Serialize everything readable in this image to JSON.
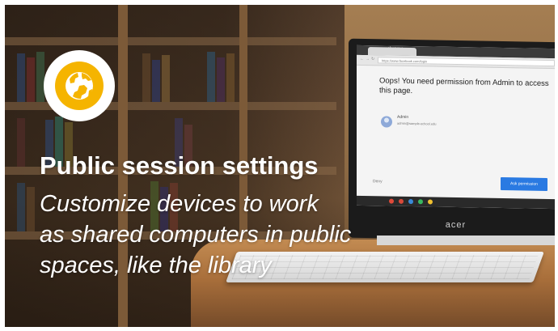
{
  "hero": {
    "title": "Public session settings",
    "subtitle_lines": [
      "Customize devices to work",
      "as shared computers in public",
      "spaces, like the library"
    ],
    "icon": "globe-icon",
    "icon_color": "#F5B400",
    "badge_color": "#FFFFFF"
  },
  "device_screen": {
    "browser_label": "chrome",
    "tab_title": "",
    "url": "https://www.facebook.com/login",
    "message": "Oops! You need permission from Admin to access this page.",
    "admin_name": "Admin",
    "admin_email": "admin@sample-school.edu",
    "deny_label": "Deny",
    "ask_button_label": "Ask permission",
    "button_color": "#2A7AE2"
  },
  "device": {
    "brand": "acer"
  }
}
